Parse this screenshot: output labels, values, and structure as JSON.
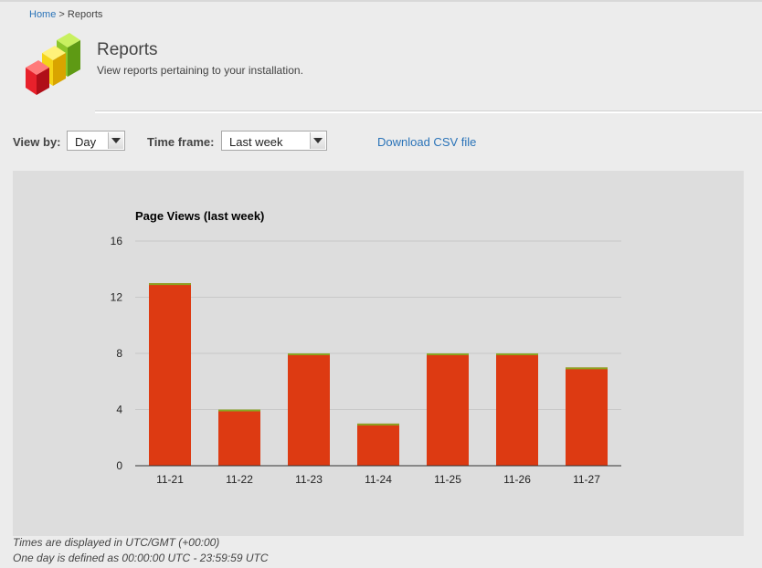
{
  "breadcrumb": {
    "home": "Home",
    "separator": " > ",
    "current": "Reports"
  },
  "header": {
    "title": "Reports",
    "subtitle": "View reports pertaining to your installation.",
    "logo_icon": "reports-bar-chart-icon"
  },
  "controls": {
    "view_by_label": "View by:",
    "view_by_value": "Day",
    "time_frame_label": "Time frame:",
    "time_frame_value": "Last week",
    "download_link": "Download CSV file"
  },
  "chart_data": {
    "type": "bar",
    "title": "Page Views (last week)",
    "categories": [
      "11-21",
      "11-22",
      "11-23",
      "11-24",
      "11-25",
      "11-26",
      "11-27"
    ],
    "values": [
      13,
      4,
      8,
      3,
      8,
      8,
      7
    ],
    "ylim": [
      0,
      16
    ],
    "yticks": [
      0,
      4,
      8,
      12,
      16
    ],
    "grid": true,
    "bar_color": "#dd3a12",
    "bar_cap_color": "#8aa422"
  },
  "footer": {
    "line1": "Times are displayed in UTC/GMT (+00:00)",
    "line2": "One day is defined as 00:00:00 UTC - 23:59:59 UTC"
  }
}
